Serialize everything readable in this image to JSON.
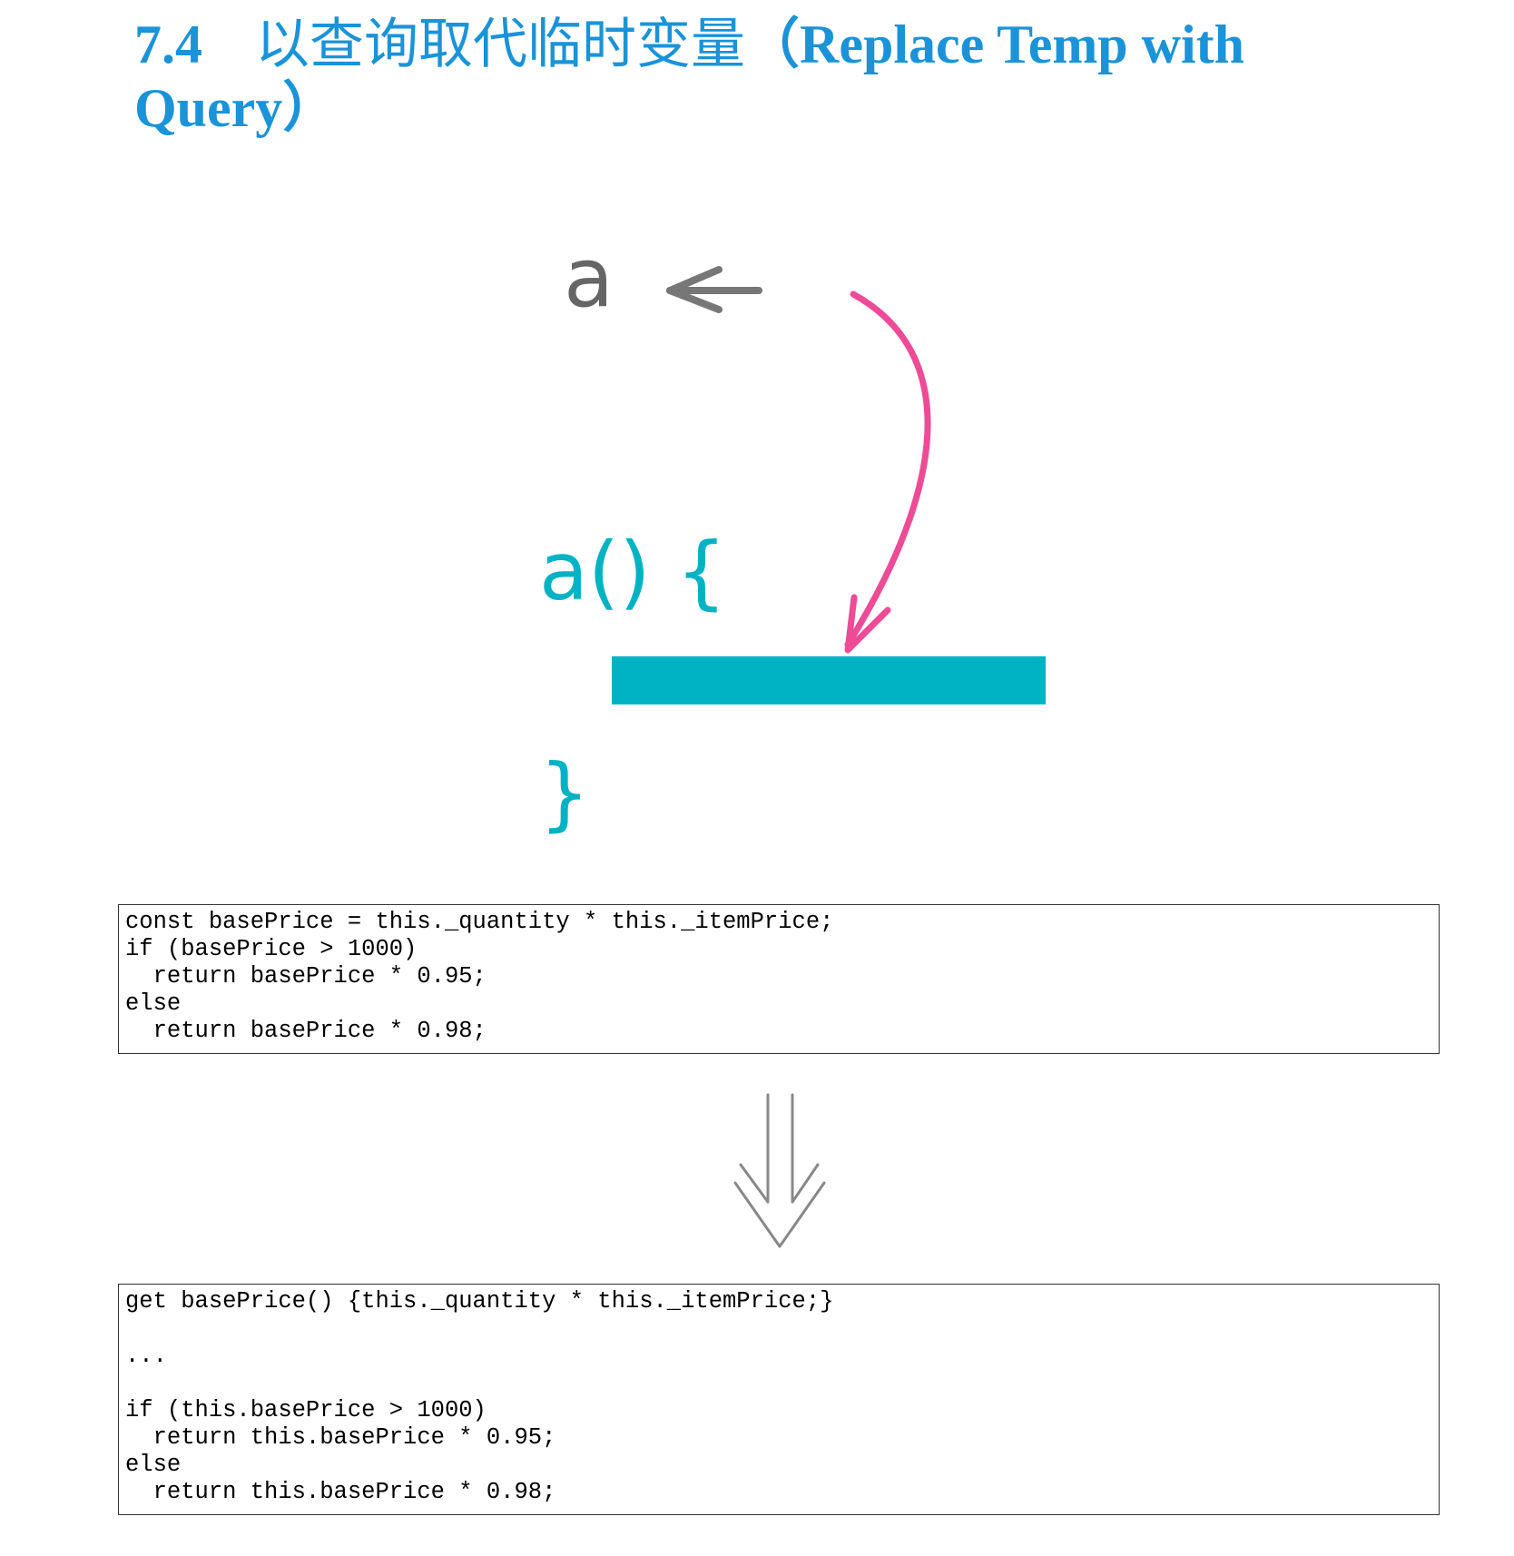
{
  "heading": {
    "number": "7.4",
    "chinese": "以查询取代临时变量",
    "english": "（Replace Temp with Query）"
  },
  "diagram": {
    "variable_label": "a",
    "function_open": "a() {",
    "function_close": "}",
    "colors": {
      "teal": "#00b3c4",
      "pink": "#ee4b97",
      "gray_arrow": "#777777",
      "variable_gray": "#555555"
    }
  },
  "code_before": [
    "const basePrice = this._quantity * this._itemPrice;",
    "if (basePrice > 1000)",
    "  return basePrice * 0.95;",
    "else",
    "  return basePrice * 0.98;"
  ],
  "code_after": [
    "get basePrice() {this._quantity * this._itemPrice;}",
    "",
    "...",
    "",
    "if (this.basePrice > 1000)",
    "  return this.basePrice * 0.95;",
    "else",
    "  return this.basePrice * 0.98;"
  ],
  "transition_arrow": "double-down-arrow-icon"
}
